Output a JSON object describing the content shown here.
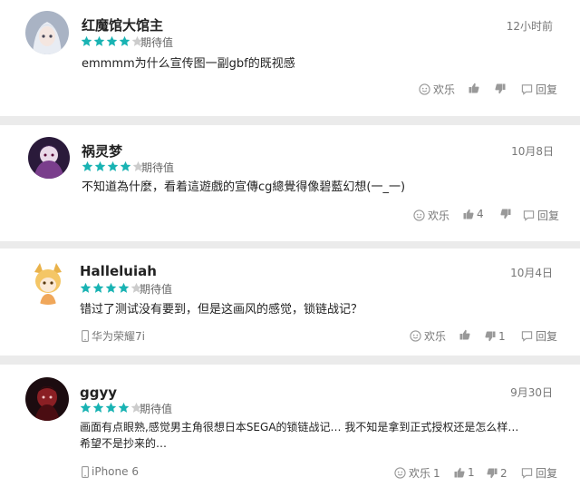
{
  "status_label": "期待值",
  "actions": {
    "like": "欢乐",
    "reply": "回复"
  },
  "comments": [
    {
      "name": "红魔馆大馆主",
      "time": "12小时前",
      "rating": 4,
      "text": "emmmm为什么宣传图一副gbf的既视感",
      "device": "",
      "like_count": "",
      "up_count": "",
      "down_count": "",
      "avatar_icon": "anime-girl-avatar"
    },
    {
      "name": "祸灵梦",
      "time": "10月8日",
      "rating": 4,
      "text": "不知道為什麼，看着這遊戲的宣傳cg總覺得像碧藍幻想(一_一)",
      "device": "",
      "like_count": "",
      "up_count": "4",
      "down_count": "",
      "avatar_icon": "purple-character-avatar"
    },
    {
      "name": "Halleluiah",
      "time": "10月4日",
      "rating": 4,
      "text": "错过了测试没有要到，但是这画风的感觉，锁链战记？",
      "device": "华为荣耀7i",
      "like_count": "",
      "up_count": "",
      "down_count": "1",
      "avatar_icon": "fox-girl-avatar"
    },
    {
      "name": "ggyy",
      "time": "9月30日",
      "rating": 4,
      "text_lines": [
        "画面有点眼熟,感觉男主角很想日本SEGA的锁链战记… 我不知是拿到正式授权还是怎么样…",
        "希望不是抄来的…"
      ],
      "device": "iPhone 6",
      "like_count": "1",
      "up_count": "1",
      "down_count": "2",
      "avatar_icon": "dark-red-avatar"
    }
  ],
  "colors": {
    "star_on": "#19b3b3",
    "star_off": "#cccccc",
    "divider": "#ebebeb"
  }
}
